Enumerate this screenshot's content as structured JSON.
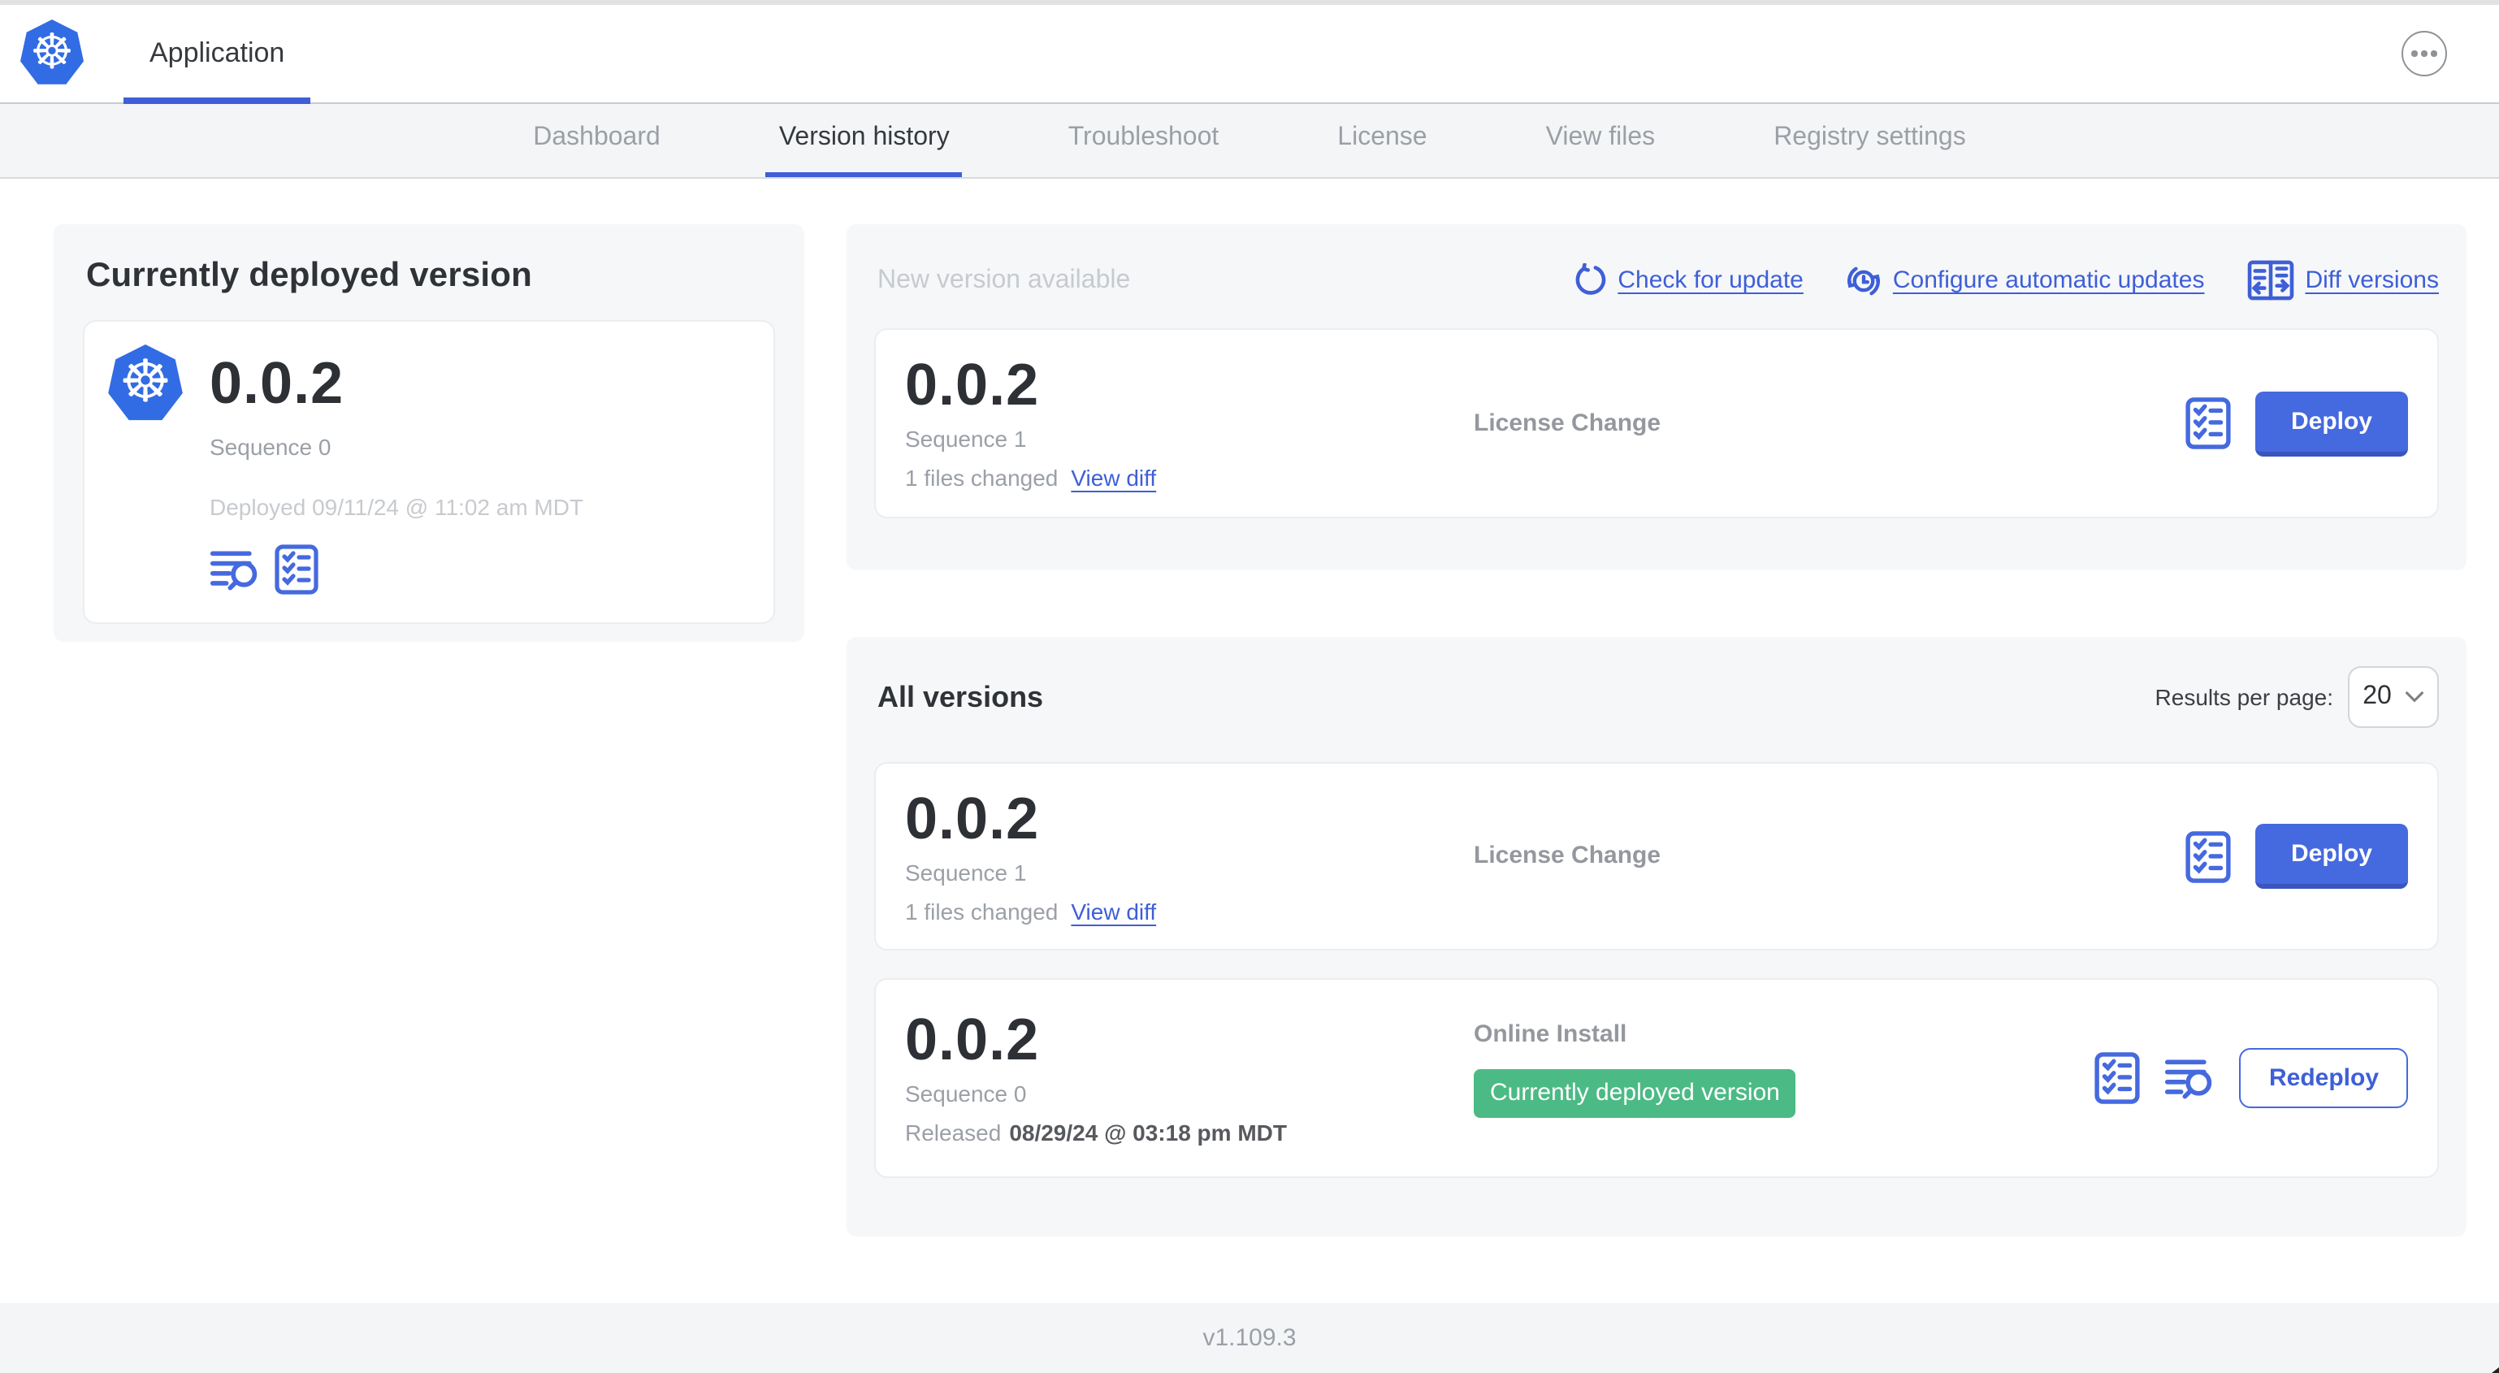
{
  "header": {
    "app_tab": "Application"
  },
  "nav": {
    "tabs": [
      {
        "label": "Dashboard",
        "active": false
      },
      {
        "label": "Version history",
        "active": true
      },
      {
        "label": "Troubleshoot",
        "active": false
      },
      {
        "label": "License",
        "active": false
      },
      {
        "label": "View files",
        "active": false
      },
      {
        "label": "Registry settings",
        "active": false
      }
    ]
  },
  "current": {
    "heading": "Currently deployed version",
    "version": "0.0.2",
    "sequence": "Sequence 0",
    "deployed": "Deployed 09/11/24 @ 11:02 am MDT"
  },
  "new_version": {
    "heading": "New version available",
    "check_link": "Check for update",
    "auto_link": "Configure automatic updates",
    "diff_link": "Diff versions",
    "card": {
      "version": "0.0.2",
      "sequence": "Sequence 1",
      "files": "1 files changed",
      "view_diff": "View diff",
      "source": "License Change",
      "action": "Deploy"
    }
  },
  "all_versions": {
    "heading": "All versions",
    "per_page_label": "Results per page:",
    "per_page_value": "20",
    "rows": [
      {
        "version": "0.0.2",
        "sequence": "Sequence 1",
        "files": "1 files changed",
        "view_diff": "View diff",
        "source": "License Change",
        "action": "Deploy"
      },
      {
        "version": "0.0.2",
        "sequence": "Sequence 0",
        "released_label": "Released",
        "released_date": "08/29/24 @ 03:18 pm MDT",
        "source": "Online Install",
        "badge": "Currently deployed version",
        "action": "Redeploy"
      }
    ]
  },
  "footer": {
    "version": "v1.109.3"
  },
  "colors": {
    "k8s_blue": "#326ce5",
    "link_blue": "#3e5fd7",
    "button_blue": "#4569de",
    "badge_green": "#4cba85"
  }
}
